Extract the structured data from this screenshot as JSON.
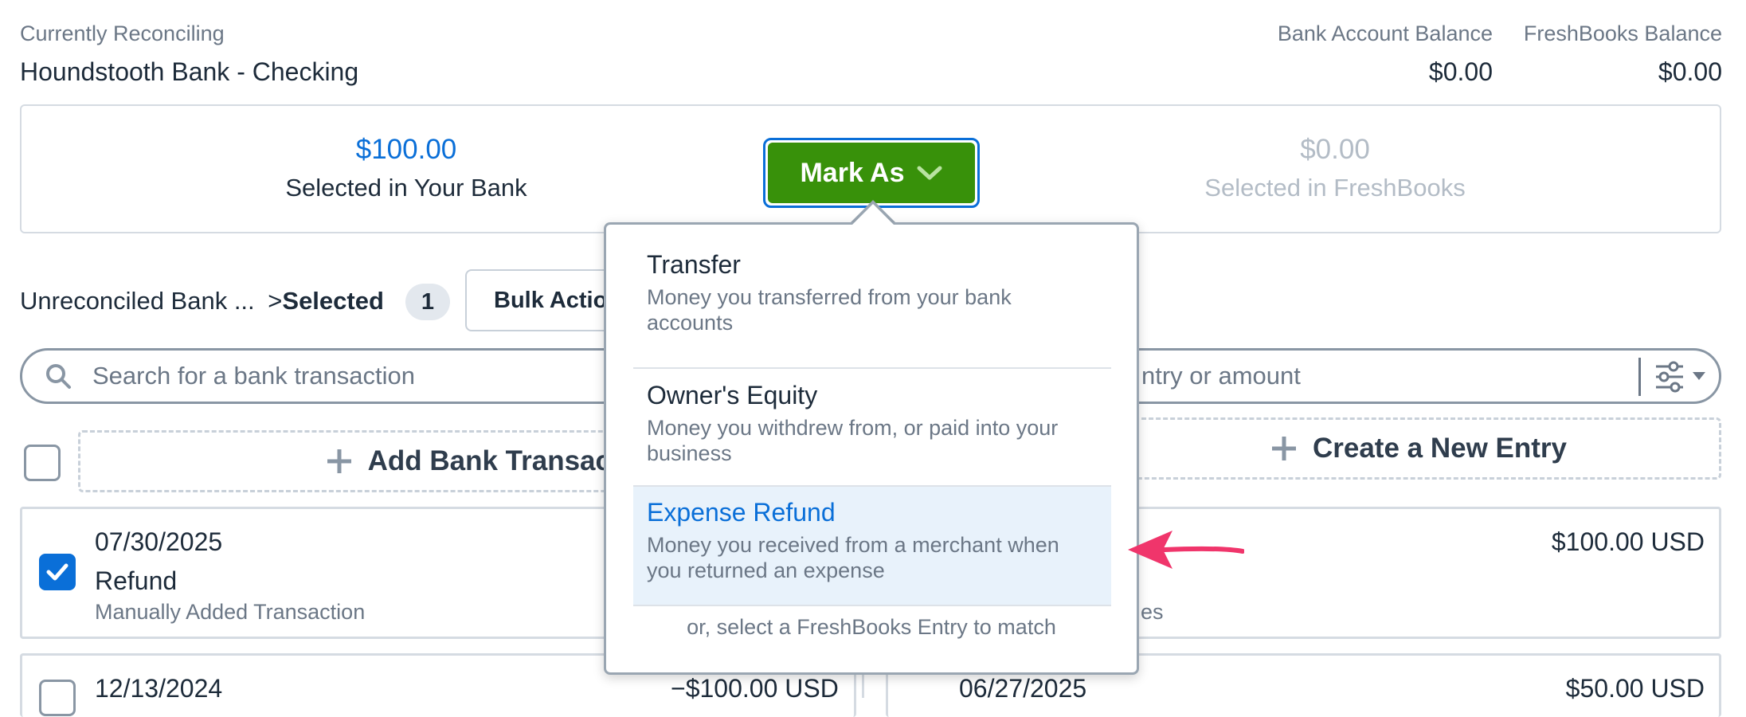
{
  "header": {
    "reconciling_label": "Currently Reconciling",
    "account_name": "Houndstooth Bank - Checking",
    "bank_balance_label": "Bank Account Balance",
    "bank_balance_value": "$0.00",
    "freshbooks_balance_label": "FreshBooks Balance",
    "freshbooks_balance_value": "$0.00"
  },
  "summary": {
    "bank_selected_amount": "$100.00",
    "bank_selected_label": "Selected in Your Bank",
    "mark_as_label": "Mark As",
    "fb_selected_amount": "$0.00",
    "fb_selected_label": "Selected in FreshBooks"
  },
  "toolbar": {
    "breadcrumb_parent": "Unreconciled Bank ...",
    "breadcrumb_separator": ">",
    "breadcrumb_current": "Selected",
    "selected_count": "1",
    "bulk_actions_label": "Bulk Actio"
  },
  "search": {
    "bank_placeholder": "Search for a bank transaction",
    "fb_placeholder": "ntry or amount"
  },
  "actions": {
    "add_bank_transaction": "Add Bank Transacti",
    "create_new_entry": "Create a New Entry"
  },
  "bank_rows": [
    {
      "date": "07/30/2025",
      "description": "Refund",
      "source": "Manually Added Transaction",
      "checked": true
    },
    {
      "date": "12/13/2024",
      "amount": "−$100.00 USD"
    }
  ],
  "fb_rows": [
    {
      "amount": "$100.00 USD",
      "source_fragment": "es"
    },
    {
      "date": "06/27/2025",
      "amount": "$50.00 USD"
    }
  ],
  "dropdown": {
    "items": [
      {
        "title": "Transfer",
        "description": "Money you transferred from your bank accounts"
      },
      {
        "title": "Owner's Equity",
        "description": "Money you withdrew from, or paid into your business"
      },
      {
        "title": "Expense Refund",
        "description": "Money you received from a merchant when you returned an expense",
        "highlighted": true
      }
    ],
    "footer": "or, select a FreshBooks Entry to match"
  },
  "colors": {
    "accent_blue": "#0a6fd8",
    "mark_as_green": "#38910a",
    "highlight_bg": "#e8f2fb",
    "annotation_arrow": "#f0356b"
  }
}
